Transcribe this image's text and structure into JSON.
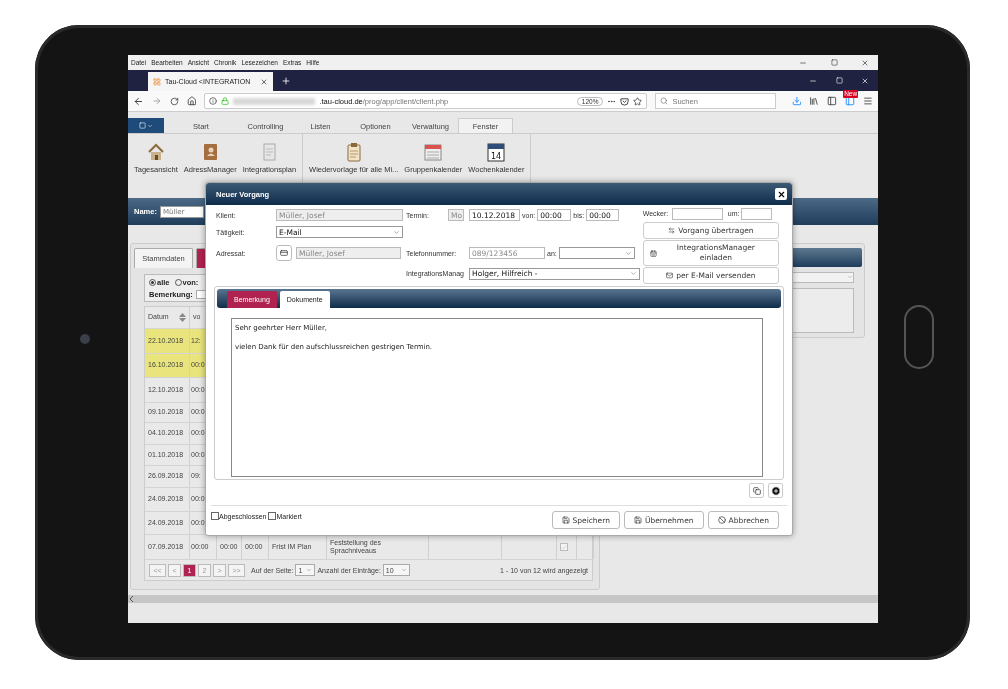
{
  "browser_menu": [
    "Datei",
    "Bearbeiten",
    "Ansicht",
    "Chronik",
    "Lesezeichen",
    "Extras",
    "Hilfe"
  ],
  "browser_tab": {
    "title": "Tau-Cloud <INTEGRATION"
  },
  "address_bar": {
    "domain": ".tau-cloud.de",
    "path": "/prog/app/client/client.php",
    "zoom": "120%"
  },
  "search": {
    "placeholder": "Suchen"
  },
  "update_badge": "New",
  "app_nav": [
    {
      "label": "Start",
      "selected": false
    },
    {
      "label": "Controlling",
      "selected": false
    },
    {
      "label": "Listen",
      "selected": false
    },
    {
      "label": "Optionen",
      "selected": false
    },
    {
      "label": "Verwaltung",
      "selected": false
    },
    {
      "label": "Fenster",
      "selected": true
    }
  ],
  "ribbon_groups": [
    {
      "items": [
        {
          "label": "Tagesansicht",
          "kind": "house"
        },
        {
          "label": "AdressManager",
          "kind": "book"
        },
        {
          "label": "Integrationsplan",
          "kind": "document"
        }
      ]
    },
    {
      "items": [
        {
          "label": "Wiedervorlage für alle Mi...",
          "kind": "clipboard"
        },
        {
          "label": "Gruppenkalender",
          "kind": "calendar"
        },
        {
          "label": "Wochenkalender",
          "kind": "week",
          "icon_text": "14"
        }
      ]
    }
  ],
  "name_filter": {
    "label": "Name:",
    "value": "Müller"
  },
  "client_panel": {
    "tabs": [
      {
        "label": "Stammdaten",
        "selected": false
      },
      {
        "selected": true
      }
    ],
    "filter": {
      "options": [
        {
          "label": "alle",
          "selected": true
        },
        {
          "label": "von:",
          "selected": false
        }
      ],
      "remark_label": "Bemerkung:"
    },
    "table": {
      "columns": [
        "Datum",
        "vo"
      ],
      "rows": [
        {
          "cells": [
            "22.10.2018",
            "12:"
          ],
          "highlighted": true
        },
        {
          "cells": [
            "16.10.2018",
            "00:0"
          ],
          "highlighted": true
        },
        {
          "cells": [
            "12.10.2018",
            "00:0"
          ],
          "highlighted": false
        },
        {
          "cells": [
            "09.10.2018",
            "00:0"
          ],
          "highlighted": false
        },
        {
          "cells": [
            "04.10.2018",
            "00:0"
          ],
          "highlighted": false
        },
        {
          "cells": [
            "01.10.2018",
            "00:0"
          ],
          "highlighted": false
        },
        {
          "cells": [
            "26.09.2018",
            "09:"
          ],
          "highlighted": false
        },
        {
          "cells": [
            "24.09.2018",
            "00:0"
          ],
          "highlighted": false
        },
        {
          "cells": [
            "24.09.2018",
            "00:0"
          ],
          "highlighted": false
        },
        {
          "cells": [
            "07.09.2018",
            "00:00",
            "00:00",
            "00:00",
            "Frist IM Plan",
            "Feststellung des Sprachniveaus"
          ],
          "highlighted": false,
          "checked": true
        }
      ]
    },
    "pager": {
      "first": "<<",
      "prev": "<",
      "pages": [
        {
          "label": "1",
          "selected": true
        },
        {
          "label": "2",
          "selected": false
        }
      ],
      "next": ">",
      "last": ">>",
      "page_label": "Auf der Seite:",
      "page": "1",
      "count_label": "Anzahl der Einträge:",
      "count": "10",
      "summary": "1 - 10 von 12 wird angezeigt"
    }
  },
  "dialog": {
    "title": "Neuer Vorgang",
    "client": {
      "label": "Klient:",
      "value": "Müller, Josef",
      "disabled": true
    },
    "activity": {
      "label": "Tätigkeit:",
      "value": "E-Mail"
    },
    "addressee": {
      "label": "Adressat:",
      "value": "Müller, Josef",
      "disabled": true
    },
    "appointment": {
      "label": "Termin:",
      "weekday": "Mo",
      "date": "10.12.2018",
      "from_label": "von:",
      "from": "00:00",
      "to_label": "bis:",
      "to": "00:00"
    },
    "phone": {
      "label": "Telefonnummer:",
      "value": "089/123456",
      "to_label": "an:"
    },
    "manager": {
      "label": "IntegrationsManag",
      "value": "Holger, Hilfreich -"
    },
    "alarm": {
      "label": "Wecker:",
      "time_label": "um:"
    },
    "actions": [
      {
        "label": "Vorgang übertragen",
        "kind": "transfer"
      },
      {
        "label": "IntegrationsManager einladen",
        "kind": "invite"
      },
      {
        "label": "per E-Mail versenden",
        "kind": "mail"
      }
    ],
    "tabs": [
      {
        "label": "Bemerkung",
        "selected": true
      },
      {
        "label": "Dokumente",
        "selected": false
      }
    ],
    "text": "Sehr geehrter Herr Müller,\n\nvielen Dank für den aufschlussreichen gestrigen Termin.",
    "flags": [
      {
        "label": "Abgeschlossen",
        "checked": false
      },
      {
        "label": "Markiert",
        "checked": false
      }
    ],
    "buttons": [
      {
        "label": "Speichern",
        "kind": "save"
      },
      {
        "label": "Übernehmen",
        "kind": "apply"
      },
      {
        "label": "Abbrechen",
        "kind": "cancel"
      }
    ]
  }
}
